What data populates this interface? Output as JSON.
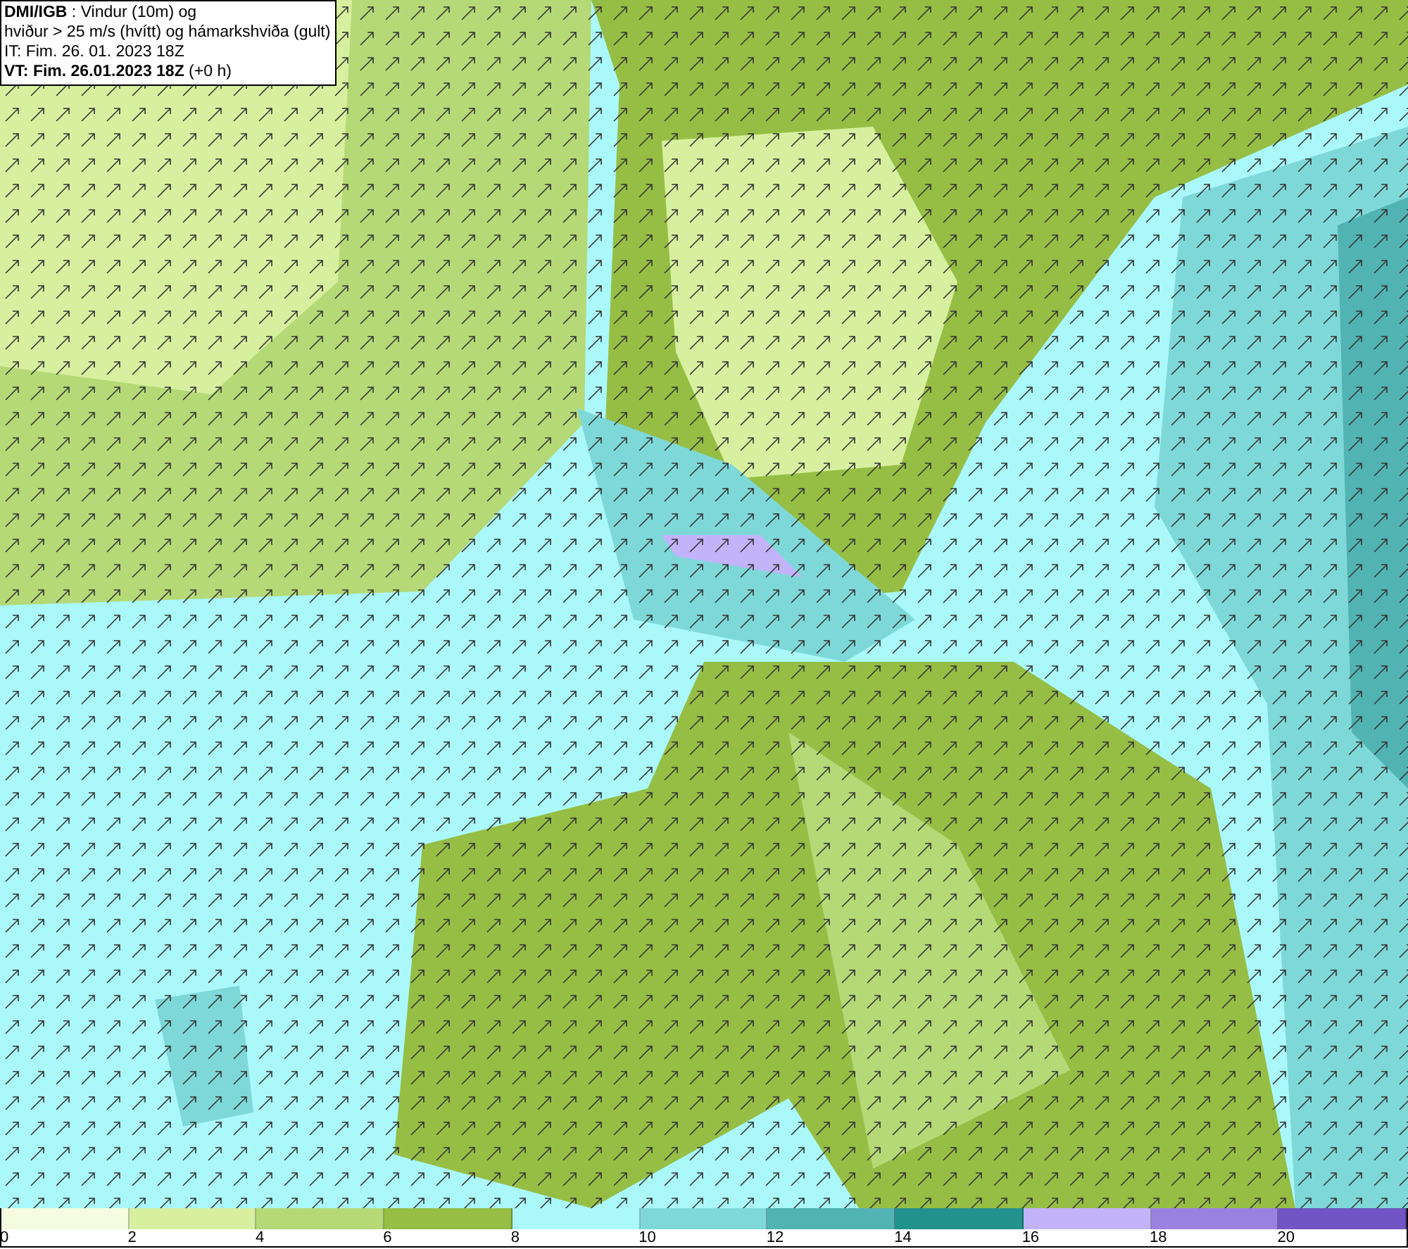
{
  "header": {
    "lines": [
      "**DMI/IGB** : Vindur (10m) og",
      "hviður > 25 m/s (hvítt) og hámarkshviða (gult)",
      "IT: Fim. 26. 01. 2023 18Z",
      "**VT: Fim. 26.01.2023 18Z** (+0 h)"
    ]
  },
  "legend": {
    "bins": [
      {
        "label": "0",
        "color": "#f5fbdf"
      },
      {
        "label": "2",
        "color": "#d7f09f"
      },
      {
        "label": "4",
        "color": "#b5d977"
      },
      {
        "label": "6",
        "color": "#96be45"
      },
      {
        "label": "8",
        "color": "#aaf8fa"
      },
      {
        "label": "10",
        "color": "#7fd8d8"
      },
      {
        "label": "12",
        "color": "#52b3b3"
      },
      {
        "label": "14",
        "color": "#22928d"
      },
      {
        "label": "16",
        "color": "#c3b3fb"
      },
      {
        "label": "18",
        "color": "#9a82e0"
      },
      {
        "label": "20",
        "color": "#7155c4"
      }
    ]
  }
}
